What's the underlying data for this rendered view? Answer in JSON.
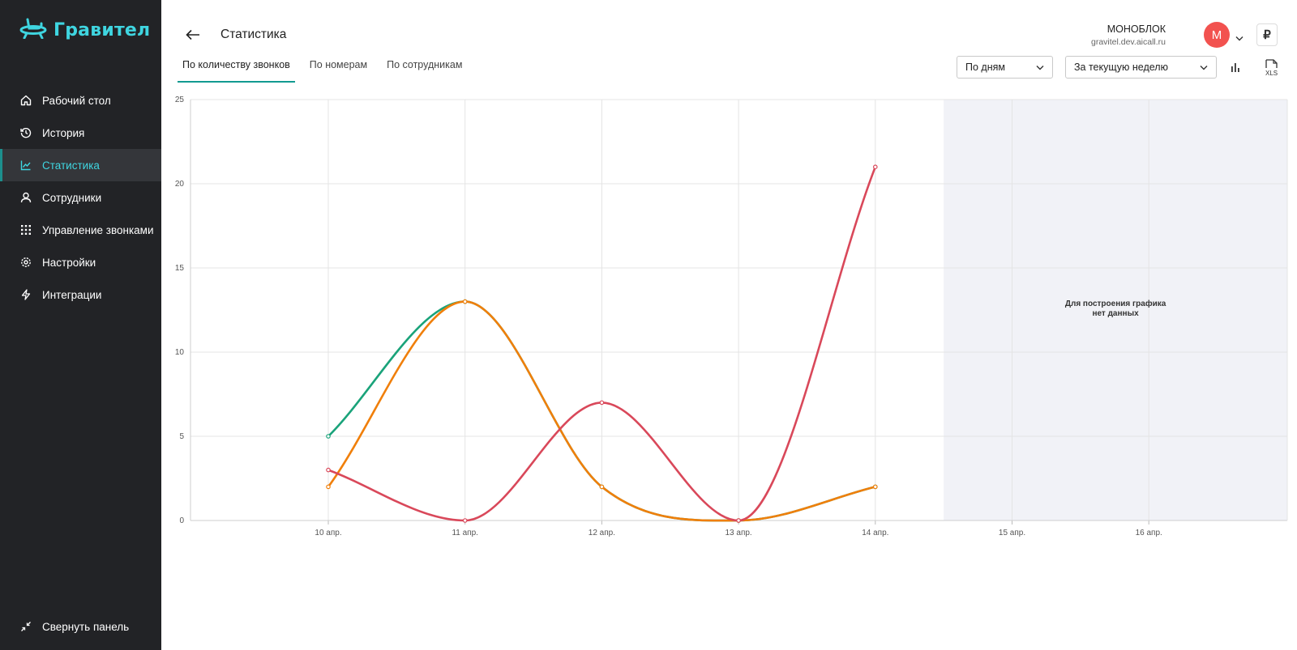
{
  "app": {
    "brand": "Гравител"
  },
  "sidebar": {
    "items": [
      {
        "label": "Рабочий стол",
        "icon": "home-icon",
        "active": false
      },
      {
        "label": "История",
        "icon": "history-icon",
        "active": false
      },
      {
        "label": "Статистика",
        "icon": "chart-icon",
        "active": true
      },
      {
        "label": "Сотрудники",
        "icon": "user-icon",
        "active": false
      },
      {
        "label": "Управление звонками",
        "icon": "dialpad-icon",
        "active": false
      },
      {
        "label": "Настройки",
        "icon": "gear-icon",
        "active": false
      },
      {
        "label": "Интеграции",
        "icon": "bolt-icon",
        "active": false
      }
    ],
    "collapse_label": "Свернуть панель"
  },
  "header": {
    "title": "Статистика",
    "tabs": [
      {
        "label": "По количеству звонков",
        "active": true
      },
      {
        "label": "По номерам",
        "active": false
      },
      {
        "label": "По сотрудникам",
        "active": false
      }
    ],
    "account": {
      "name": "МОНОБЛОК",
      "domain": "gravitel.dev.aicall.ru",
      "avatar_letter": "М"
    },
    "currency_symbol": "₽",
    "filters": {
      "group_by": "По дням",
      "period": "За текущую неделю"
    },
    "export_label": "XLS"
  },
  "colors": {
    "sidebar_bg": "#222326",
    "accent": "#3fd5e0",
    "tab_underline": "#129a91",
    "avatar": "#f2524f"
  },
  "chart_data": {
    "type": "line",
    "x": [
      "10 апр.",
      "11 апр.",
      "12 апр.",
      "13 апр.",
      "14 апр.",
      "15 апр.",
      "16 апр."
    ],
    "ylim": [
      0,
      25
    ],
    "yticks": [
      0,
      5,
      10,
      15,
      20,
      25
    ],
    "grid": true,
    "series": [
      {
        "color": "#1aa37a",
        "values": [
          5,
          13,
          2,
          0,
          2,
          null,
          null
        ]
      },
      {
        "color": "#f07f0a",
        "values": [
          2,
          13,
          2,
          0,
          2,
          null,
          null
        ]
      },
      {
        "color": "#d9485a",
        "values": [
          3,
          0,
          7,
          0,
          21,
          null,
          null
        ]
      }
    ],
    "no_data_range": [
      "15 апр.",
      "16 апр."
    ],
    "no_data_text": [
      "Для построения графика",
      "нет данных"
    ]
  }
}
